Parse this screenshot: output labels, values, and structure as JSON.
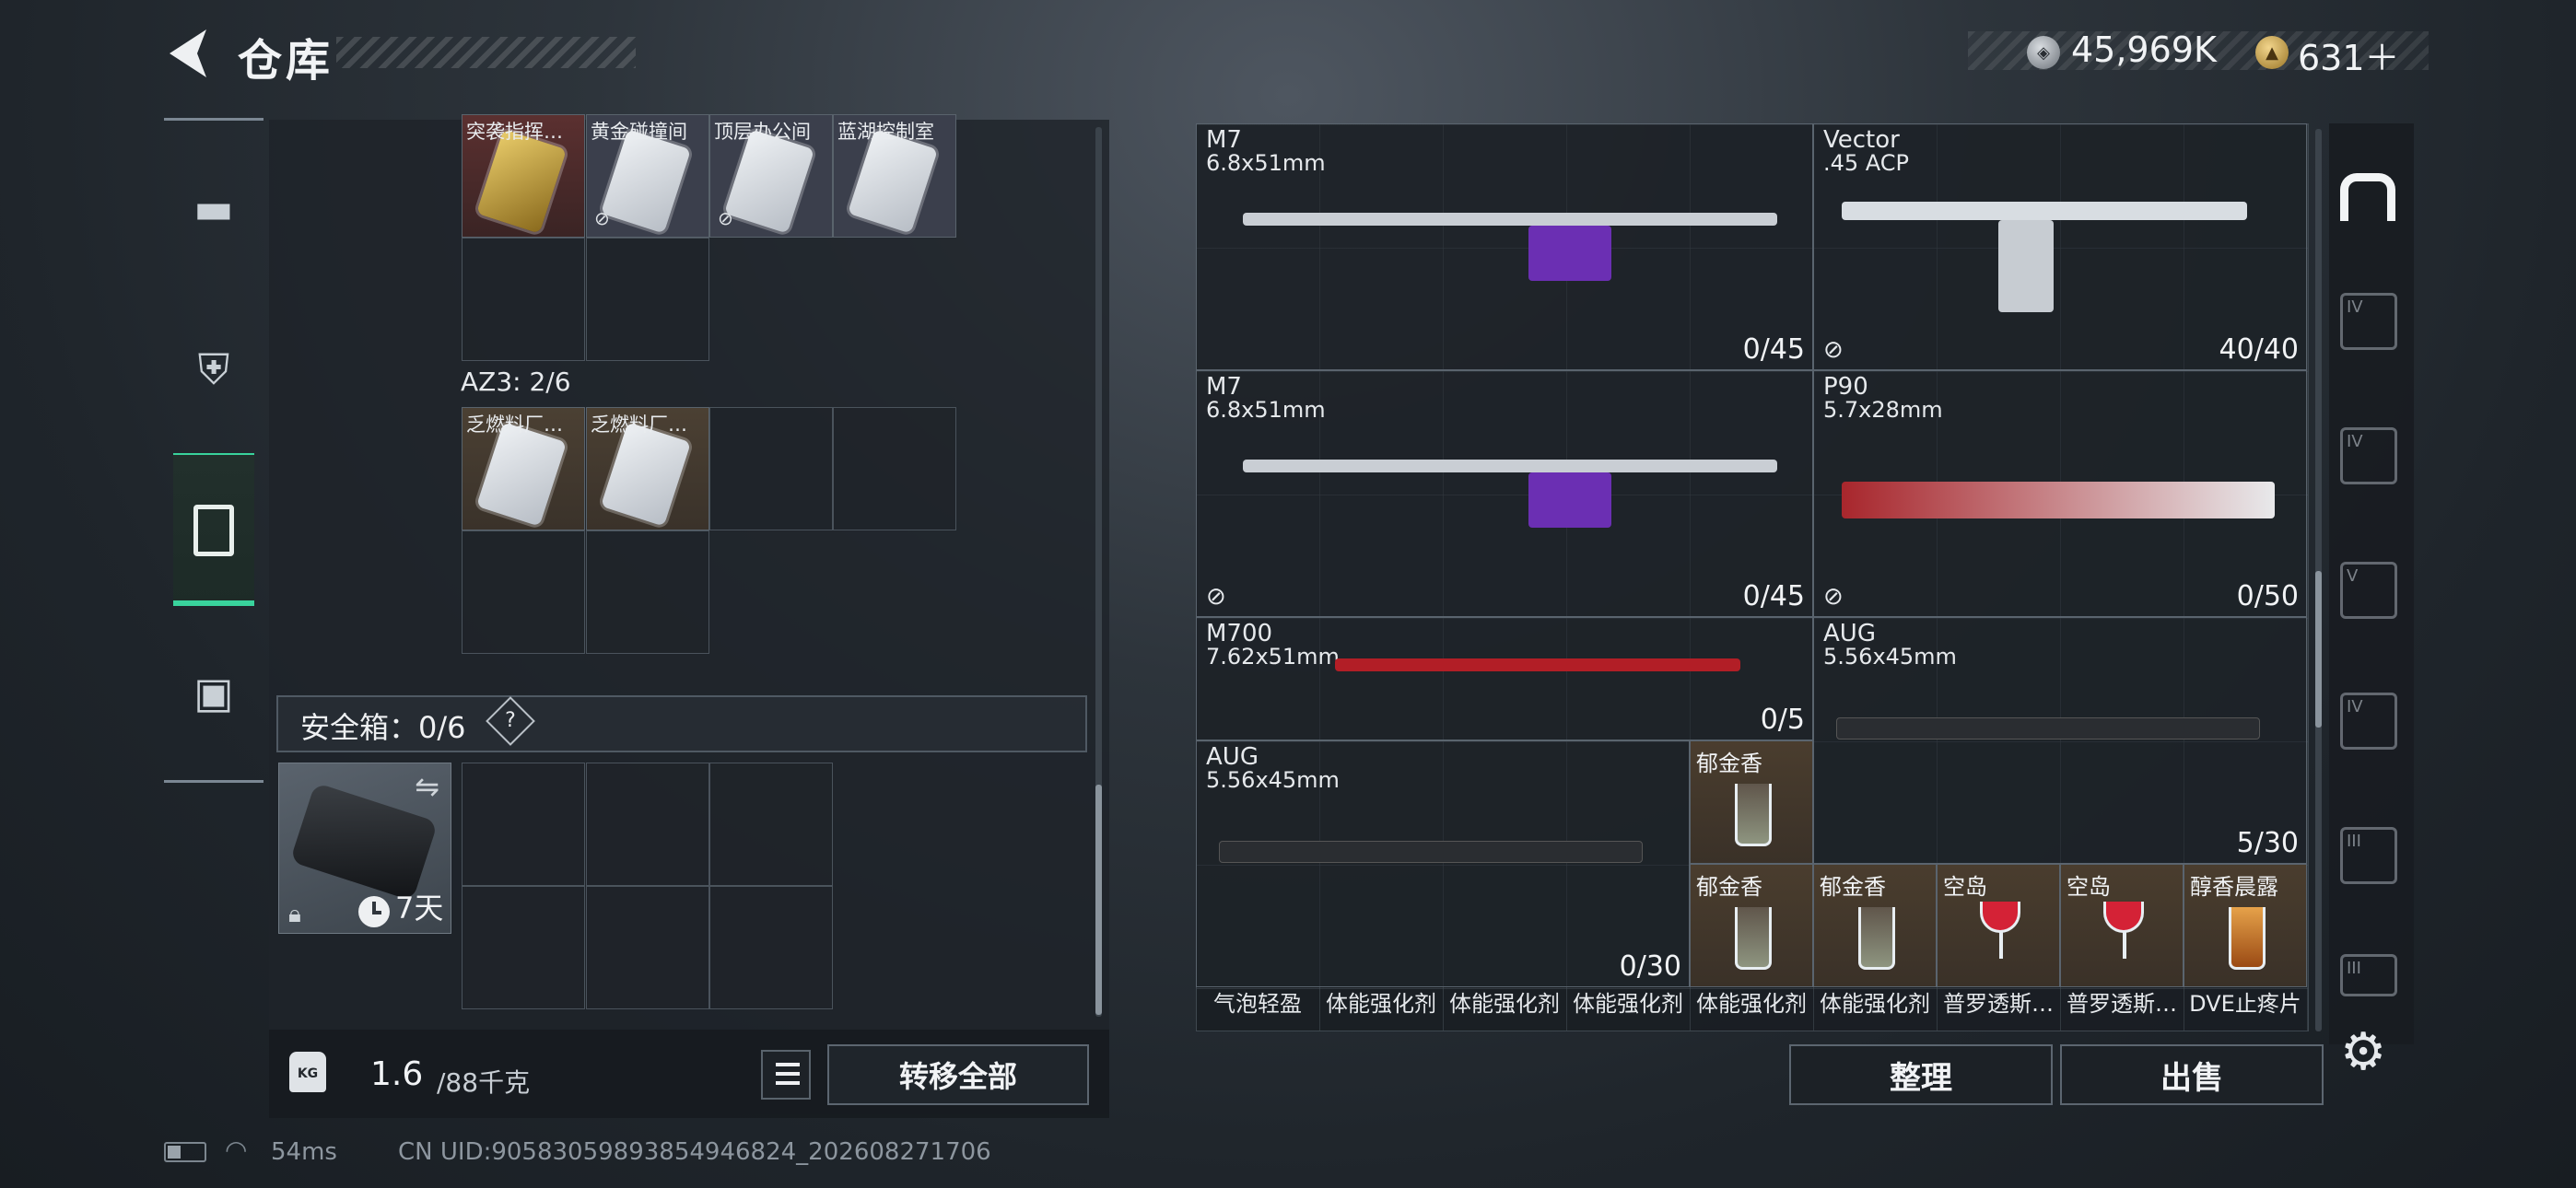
{
  "header": {
    "title": "仓库",
    "silver_amount": "45,969K",
    "gold_amount": "631＋",
    "gold_plus_hint": "+"
  },
  "colors": {
    "accent_green": "#39d39c",
    "panel_bg": "#1f252b",
    "drink_bg": "#4a3d2e"
  },
  "left_nav": {
    "items": [
      {
        "icon": "pistol-icon",
        "active": false
      },
      {
        "icon": "vest-icon",
        "active": false
      },
      {
        "icon": "backpack-icon",
        "active": true
      },
      {
        "icon": "toolbox-icon",
        "active": false
      }
    ]
  },
  "inventory": {
    "top_items": [
      {
        "name": "突袭指挥…",
        "icon": "gold-card-icon",
        "unavailable": false
      },
      {
        "name": "黄金碰撞间",
        "icon": "keycard-icon",
        "unavailable": true
      },
      {
        "name": "顶层办公间",
        "icon": "keycard-icon",
        "unavailable": true
      },
      {
        "name": "蓝湖控制室",
        "icon": "keycard-icon",
        "unavailable": false
      }
    ],
    "az3_label": "AZ3: 2/6",
    "az3_items": [
      {
        "name": "乏燃料厂…",
        "icon": "keycard-icon"
      },
      {
        "name": "乏燃料厂…",
        "icon": "keycard-icon"
      }
    ],
    "safe_label": "安全箱：0/6",
    "safe_help": "?",
    "safe_case": {
      "duration": "7天"
    }
  },
  "footer_left": {
    "weight_value": "1.6",
    "weight_max": "/88千克",
    "kg_label": "KG",
    "transfer_label": "转移全部"
  },
  "weapons": [
    {
      "name": "M7",
      "caliber": "6.8x51mm",
      "count": "0/45",
      "no_icon": false
    },
    {
      "name": "Vector",
      "caliber": ".45 ACP",
      "count": "40/40",
      "no_icon": true
    },
    {
      "name": "M7",
      "caliber": "6.8x51mm",
      "count": "0/45",
      "no_icon": true
    },
    {
      "name": "P90",
      "caliber": "5.7x28mm",
      "count": "0/50",
      "no_icon": true
    },
    {
      "name": "M700",
      "caliber": "7.62x51mm",
      "count": "0/5",
      "no_icon": false
    },
    {
      "name": "AUG",
      "caliber": "5.56x45mm",
      "count": "5/30",
      "no_icon": false
    },
    {
      "name": "AUG",
      "caliber": "5.56x45mm",
      "count": "0/30",
      "no_icon": false
    }
  ],
  "drinks": [
    {
      "name": "郁金香",
      "style": "mojito"
    },
    {
      "name": "郁金香",
      "style": "mojito"
    },
    {
      "name": "郁金香",
      "style": "mojito"
    },
    {
      "name": "空岛",
      "style": "red"
    },
    {
      "name": "空岛",
      "style": "red"
    },
    {
      "name": "醇香晨露",
      "style": "amber"
    }
  ],
  "bottom_row": [
    "气泡轻盈",
    "体能强化剂",
    "体能强化剂",
    "体能强化剂",
    "体能强化剂",
    "体能强化剂",
    "普罗透斯…",
    "普罗透斯…",
    "DVE止疼片"
  ],
  "right_tabs": [
    {
      "icon": "home-icon",
      "tier": ""
    },
    {
      "icon": "folder-icon",
      "tier": "IV"
    },
    {
      "icon": "medkit-icon",
      "tier": "IV"
    },
    {
      "icon": "map-icon",
      "tier": "V"
    },
    {
      "icon": "map-icon",
      "tier": "IV"
    },
    {
      "icon": "map-icon",
      "tier": "III"
    },
    {
      "icon": "map-icon",
      "tier": "III"
    }
  ],
  "actions": {
    "sort_label": "整理",
    "sell_label": "出售"
  },
  "status": {
    "ping": "54ms",
    "uid": "CN UID:9058305989385494682​4_202608271706"
  }
}
